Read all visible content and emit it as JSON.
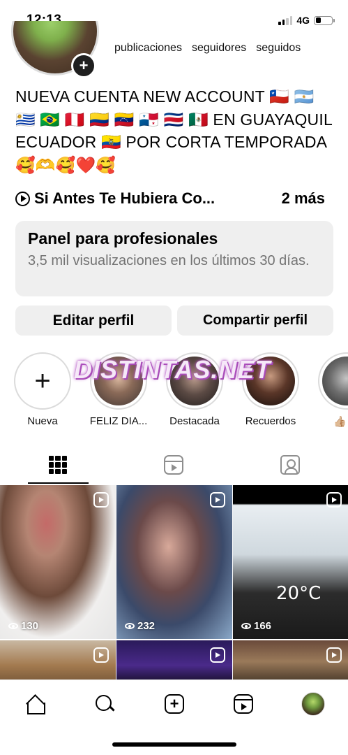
{
  "status_bar": {
    "time": "12:13",
    "network": "4G",
    "battery_level": 0.35
  },
  "profile": {
    "stat_labels": [
      "publicaciones",
      "seguidores",
      "seguidos"
    ],
    "bio": "NUEVA CUENTA NEW ACCOUNT 🇨🇱 🇦🇷 🇺🇾 🇧🇷 🇵🇪 🇨🇴 🇻🇪 🇵🇦 🇨🇷 🇲🇽 EN GUAYAQUIL ECUADOR 🇪🇨 POR CORTA TEMPORADA 🥰🫶🥰❤️🥰",
    "song_title": "Si Antes Te Hubiera Co...",
    "song_more": "2 más",
    "add_badge": "+"
  },
  "pro_panel": {
    "title": "Panel para profesionales",
    "subtitle": "3,5 mil visualizaciones en los últimos 30 días."
  },
  "buttons": {
    "edit": "Editar perfil",
    "share": "Compartir perfil"
  },
  "highlights": {
    "new_plus": "+",
    "items": [
      {
        "label": "Nueva"
      },
      {
        "label": "FELIZ DIA..."
      },
      {
        "label": "Destacada"
      },
      {
        "label": "Recuerdos"
      },
      {
        "label": "👍🏼👍🏼"
      }
    ]
  },
  "watermark": "DISTINTAS.NET",
  "posts": [
    {
      "views": "130"
    },
    {
      "views": "232"
    },
    {
      "views": "166",
      "overlay_text": "20°C"
    }
  ],
  "colors": {
    "panel_bg": "#efefef",
    "muted_text": "#737373",
    "icon_gray": "#8e8e8e"
  }
}
